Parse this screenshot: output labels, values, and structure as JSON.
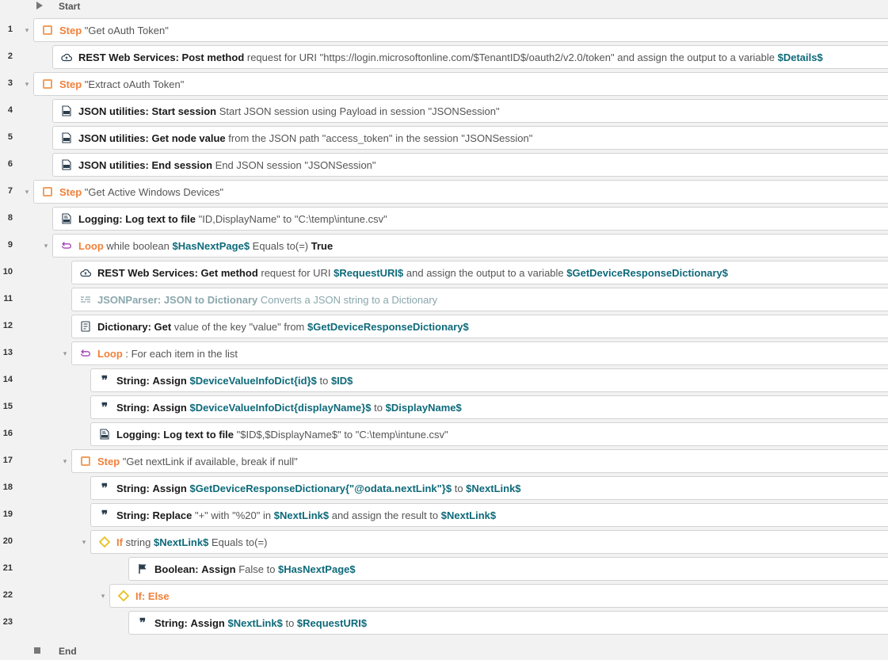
{
  "start_label": "Start",
  "end_label": "End",
  "rows": [
    {
      "n": "1",
      "indent": 0,
      "chev": true,
      "icon": "step",
      "parts": [
        [
          "kw-orange",
          "Step"
        ],
        [
          "desc",
          " \"Get oAuth Token\""
        ]
      ]
    },
    {
      "n": "2",
      "indent": 1,
      "chev": false,
      "icon": "cloud",
      "parts": [
        [
          "kw",
          "REST Web Services: Post method"
        ],
        [
          "desc",
          " request for URI \"https://login.microsoftonline.com/$TenantID$/oauth2/v2.0/token\" and assign the output to a variable "
        ],
        [
          "var",
          "$Details$"
        ]
      ]
    },
    {
      "n": "3",
      "indent": 0,
      "chev": true,
      "icon": "step",
      "parts": [
        [
          "kw-orange",
          "Step"
        ],
        [
          "desc",
          " \"Extract oAuth Token\""
        ]
      ]
    },
    {
      "n": "4",
      "indent": 1,
      "chev": false,
      "icon": "json",
      "parts": [
        [
          "kw",
          "JSON utilities: Start session"
        ],
        [
          "desc",
          " Start JSON session using Payload in session \"JSONSession\""
        ]
      ]
    },
    {
      "n": "5",
      "indent": 1,
      "chev": false,
      "icon": "json",
      "parts": [
        [
          "kw",
          "JSON utilities: Get node value"
        ],
        [
          "desc",
          " from the JSON path \"access_token\" in the session \"JSONSession\""
        ]
      ]
    },
    {
      "n": "6",
      "indent": 1,
      "chev": false,
      "icon": "json",
      "parts": [
        [
          "kw",
          "JSON utilities: End session"
        ],
        [
          "desc",
          " End JSON session \"JSONSession\""
        ]
      ]
    },
    {
      "n": "7",
      "indent": 0,
      "chev": true,
      "icon": "step",
      "parts": [
        [
          "kw-orange",
          "Step"
        ],
        [
          "desc",
          " \"Get Active Windows Devices\""
        ]
      ]
    },
    {
      "n": "8",
      "indent": 1,
      "chev": false,
      "icon": "doc",
      "parts": [
        [
          "kw",
          "Logging: Log text to file"
        ],
        [
          "desc",
          " \"ID,DisplayName\" to \"C:\\temp\\intune.csv\""
        ]
      ]
    },
    {
      "n": "9",
      "indent": 1,
      "chev": true,
      "icon": "loop",
      "parts": [
        [
          "kw-purple",
          "Loop"
        ],
        [
          "desc",
          " while boolean "
        ],
        [
          "var",
          "$HasNextPage$"
        ],
        [
          "desc",
          " Equals to(=) "
        ],
        [
          "kw",
          "True"
        ]
      ]
    },
    {
      "n": "10",
      "indent": 2,
      "chev": false,
      "icon": "cloud",
      "parts": [
        [
          "kw",
          "REST Web Services: Get method"
        ],
        [
          "desc",
          " request for URI "
        ],
        [
          "var",
          "$RequestURI$"
        ],
        [
          "desc",
          " and assign the output to a variable "
        ],
        [
          "var",
          "$GetDeviceResponseDictionary$"
        ]
      ]
    },
    {
      "n": "11",
      "indent": 2,
      "chev": false,
      "icon": "parser",
      "muted": true,
      "parts": [
        [
          "kw",
          "JSONParser: JSON to Dictionary"
        ],
        [
          "desc",
          " Converts a JSON string to a Dictionary"
        ]
      ]
    },
    {
      "n": "12",
      "indent": 2,
      "chev": false,
      "icon": "dict",
      "parts": [
        [
          "kw",
          "Dictionary: Get"
        ],
        [
          "desc",
          " value of the key \"value\" from "
        ],
        [
          "var",
          "$GetDeviceResponseDictionary$"
        ]
      ]
    },
    {
      "n": "13",
      "indent": 2,
      "chev": true,
      "icon": "loop",
      "parts": [
        [
          "kw-purple",
          "Loop"
        ],
        [
          "desc",
          " : For each item in the list"
        ]
      ]
    },
    {
      "n": "14",
      "indent": 3,
      "chev": false,
      "icon": "quote",
      "parts": [
        [
          "kw",
          "String: Assign"
        ],
        [
          "desc",
          " "
        ],
        [
          "var",
          "$DeviceValueInfoDict{id}$"
        ],
        [
          "desc",
          " to "
        ],
        [
          "var",
          "$ID$"
        ]
      ]
    },
    {
      "n": "15",
      "indent": 3,
      "chev": false,
      "icon": "quote",
      "parts": [
        [
          "kw",
          "String: Assign"
        ],
        [
          "desc",
          " "
        ],
        [
          "var",
          "$DeviceValueInfoDict{displayName}$"
        ],
        [
          "desc",
          " to "
        ],
        [
          "var",
          "$DisplayName$"
        ]
      ]
    },
    {
      "n": "16",
      "indent": 3,
      "chev": false,
      "icon": "doc",
      "parts": [
        [
          "kw",
          "Logging: Log text to file"
        ],
        [
          "desc",
          " \"$ID$,$DisplayName$\" to \"C:\\temp\\intune.csv\""
        ]
      ]
    },
    {
      "n": "17",
      "indent": 2,
      "chev": true,
      "icon": "step",
      "parts": [
        [
          "kw-orange",
          "Step"
        ],
        [
          "desc",
          " \"Get nextLink if available, break if null\""
        ]
      ]
    },
    {
      "n": "18",
      "indent": 3,
      "chev": false,
      "icon": "quote",
      "parts": [
        [
          "kw",
          "String: Assign"
        ],
        [
          "desc",
          " "
        ],
        [
          "var",
          "$GetDeviceResponseDictionary{\"@odata.nextLink\"}$"
        ],
        [
          "desc",
          " to "
        ],
        [
          "var",
          "$NextLink$"
        ]
      ]
    },
    {
      "n": "19",
      "indent": 3,
      "chev": false,
      "icon": "quote",
      "parts": [
        [
          "kw",
          "String: Replace"
        ],
        [
          "desc",
          " \"+\" with \"%20\" in "
        ],
        [
          "var",
          "$NextLink$"
        ],
        [
          "desc",
          " and assign the result to "
        ],
        [
          "var",
          "$NextLink$"
        ]
      ]
    },
    {
      "n": "20",
      "indent": 3,
      "chev": true,
      "icon": "if",
      "parts": [
        [
          "kw-orange",
          "If"
        ],
        [
          "desc",
          " string "
        ],
        [
          "var",
          "$NextLink$"
        ],
        [
          "desc",
          " Equals to(=)"
        ]
      ]
    },
    {
      "n": "21",
      "indent": 5,
      "chev": false,
      "icon": "flag",
      "parts": [
        [
          "kw",
          "Boolean: Assign"
        ],
        [
          "desc",
          " False to "
        ],
        [
          "var",
          "$HasNextPage$"
        ]
      ]
    },
    {
      "n": "22",
      "indent": 4,
      "chev": true,
      "icon": "if",
      "parts": [
        [
          "kw-orange",
          "If: Else"
        ]
      ]
    },
    {
      "n": "23",
      "indent": 5,
      "chev": false,
      "icon": "quote",
      "parts": [
        [
          "kw",
          "String: Assign"
        ],
        [
          "desc",
          " "
        ],
        [
          "var",
          "$NextLink$"
        ],
        [
          "desc",
          " to "
        ],
        [
          "var",
          "$RequestURI$"
        ]
      ]
    }
  ]
}
